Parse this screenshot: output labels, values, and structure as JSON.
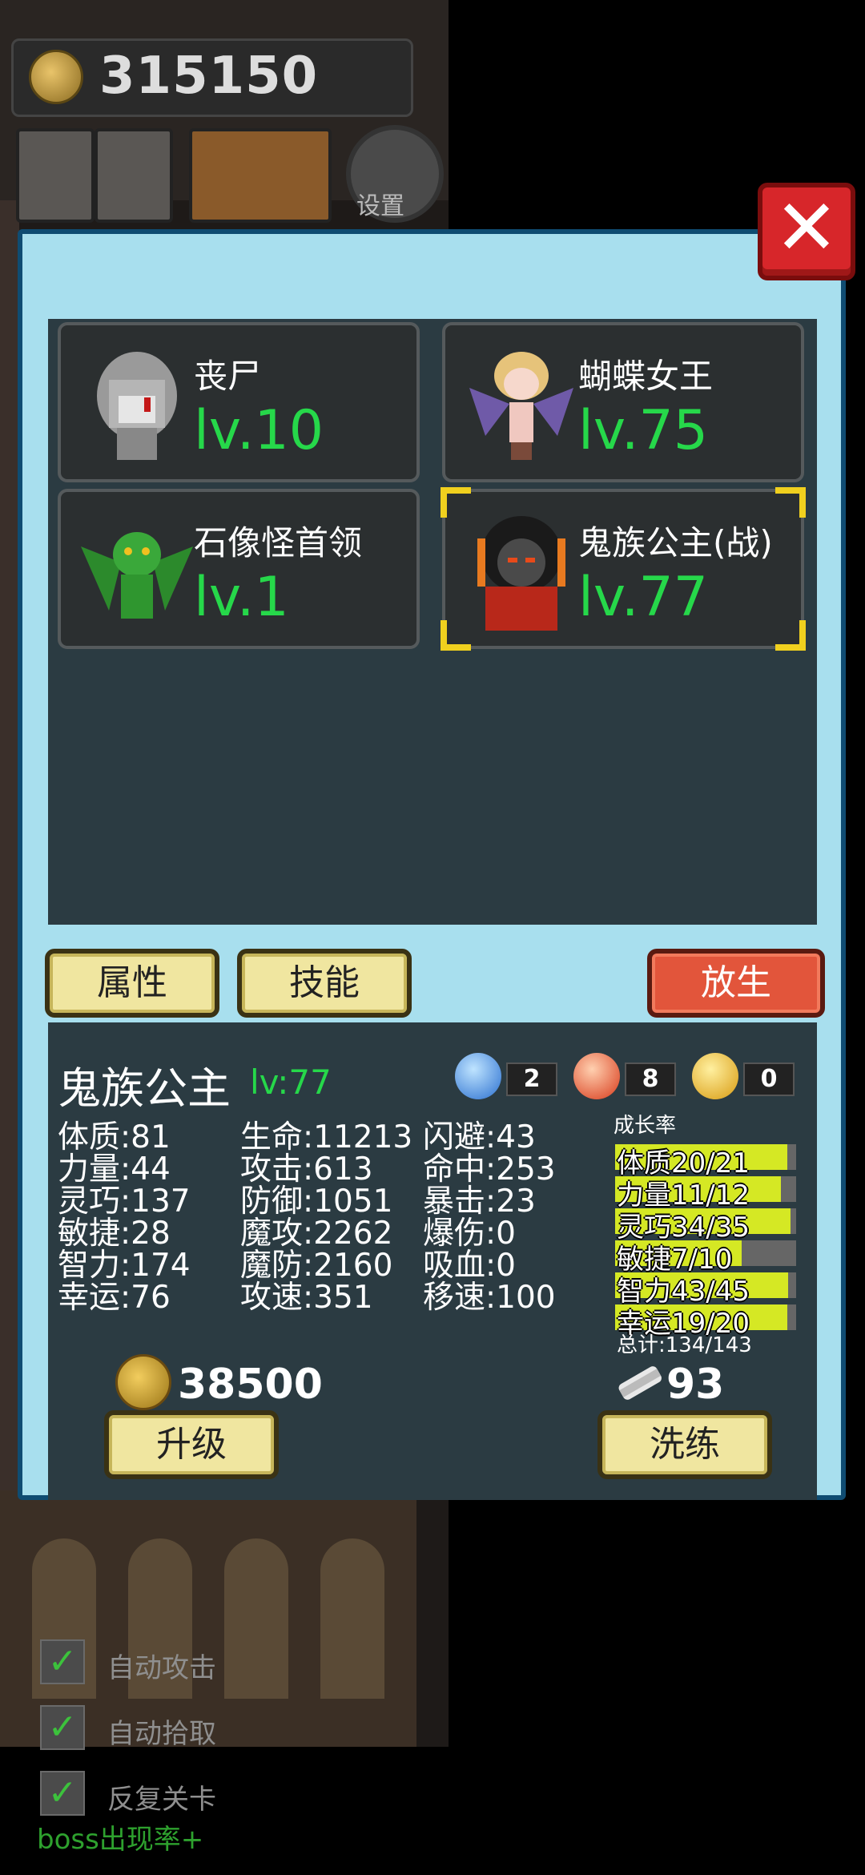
{
  "hud": {
    "gold": "315150",
    "settings_label": "设置"
  },
  "toggles": [
    {
      "label": "自动攻击",
      "checked": true
    },
    {
      "label": "自动拾取",
      "checked": true
    },
    {
      "label": "反复关卡",
      "checked": true
    }
  ],
  "boss_rate_label": "boss出现率+",
  "dialog": {
    "close_glyph": "✕",
    "pets": [
      {
        "name": "丧尸",
        "level": "lv.10",
        "icon": "zombie-sprite",
        "selected": false
      },
      {
        "name": "蝴蝶女王",
        "level": "lv.75",
        "icon": "butterfly-queen-sprite",
        "selected": false
      },
      {
        "name": "石像怪首领",
        "level": "lv.1",
        "icon": "gargoyle-sprite",
        "selected": false
      },
      {
        "name": "鬼族公主(战)",
        "level": "lv.77",
        "icon": "demon-princess-sprite",
        "selected": true
      }
    ],
    "tabs": {
      "attributes": "属性",
      "skills": "技能",
      "release": "放生"
    },
    "detail": {
      "name": "鬼族公主",
      "level": "lv:77",
      "orbs": [
        {
          "icon": "water-orb-icon",
          "count": "2",
          "color": "#3a8be0"
        },
        {
          "icon": "fire-orb-icon",
          "count": "8",
          "color": "#e84a2a"
        },
        {
          "icon": "lightning-orb-icon",
          "count": "0",
          "color": "#e8b820"
        }
      ],
      "stats_col1": [
        "体质:81",
        "力量:44",
        "灵巧:137",
        "敏捷:28",
        "智力:174",
        "幸运:76"
      ],
      "stats_col2": [
        "生命:11213",
        "攻击:613",
        "防御:1051",
        "魔攻:2262",
        "魔防:2160",
        "攻速:351"
      ],
      "stats_col3": [
        "闪避:43",
        "命中:253",
        "暴击:23",
        "爆伤:0",
        "吸血:0",
        "移速:100"
      ],
      "growth_title": "成长率",
      "growth": [
        {
          "label": "体质20/21",
          "fraction": 0.952
        },
        {
          "label": "力量11/12",
          "fraction": 0.917
        },
        {
          "label": "灵巧34/35",
          "fraction": 0.971
        },
        {
          "label": "敏捷7/10",
          "fraction": 0.7
        },
        {
          "label": "智力43/45",
          "fraction": 0.956
        },
        {
          "label": "幸运19/20",
          "fraction": 0.95
        }
      ],
      "growth_total": "总计:134/143",
      "upgrade_cost": "38500",
      "scroll_count": "93",
      "upgrade_label": "升级",
      "reroll_label": "洗练"
    }
  }
}
